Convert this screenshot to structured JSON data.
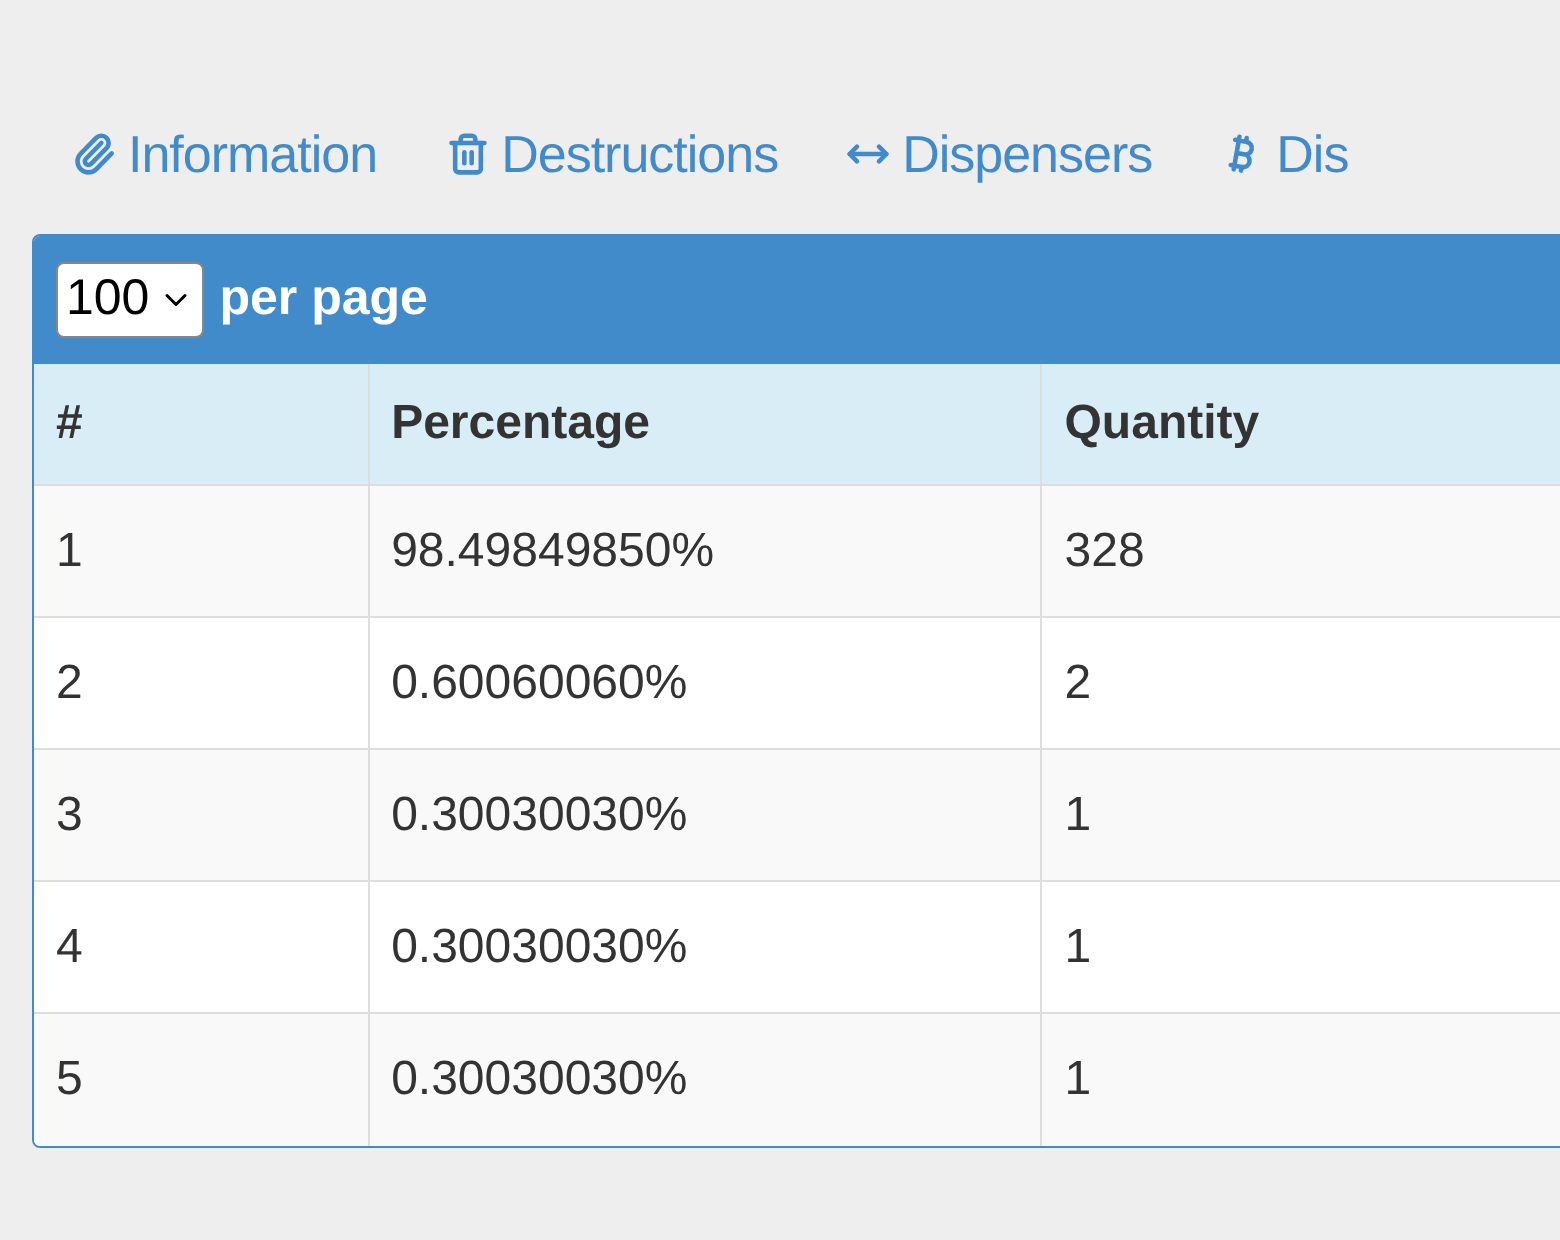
{
  "tabs": [
    {
      "label": "Information",
      "kind": "paperclip"
    },
    {
      "label": "Destructions",
      "kind": "trash"
    },
    {
      "label": "Dispensers",
      "kind": "arrows"
    },
    {
      "label": "Dis",
      "kind": "bitcoin"
    }
  ],
  "pager": {
    "value": "100",
    "label": "per page"
  },
  "table": {
    "columns": [
      "#",
      "Percentage",
      "Quantity"
    ],
    "rows": [
      [
        "1",
        "98.49849850%",
        "328"
      ],
      [
        "2",
        "0.60060060%",
        "2"
      ],
      [
        "3",
        "0.30030030%",
        "1"
      ],
      [
        "4",
        "0.30030030%",
        "1"
      ],
      [
        "5",
        "0.30030030%",
        "1"
      ]
    ]
  }
}
